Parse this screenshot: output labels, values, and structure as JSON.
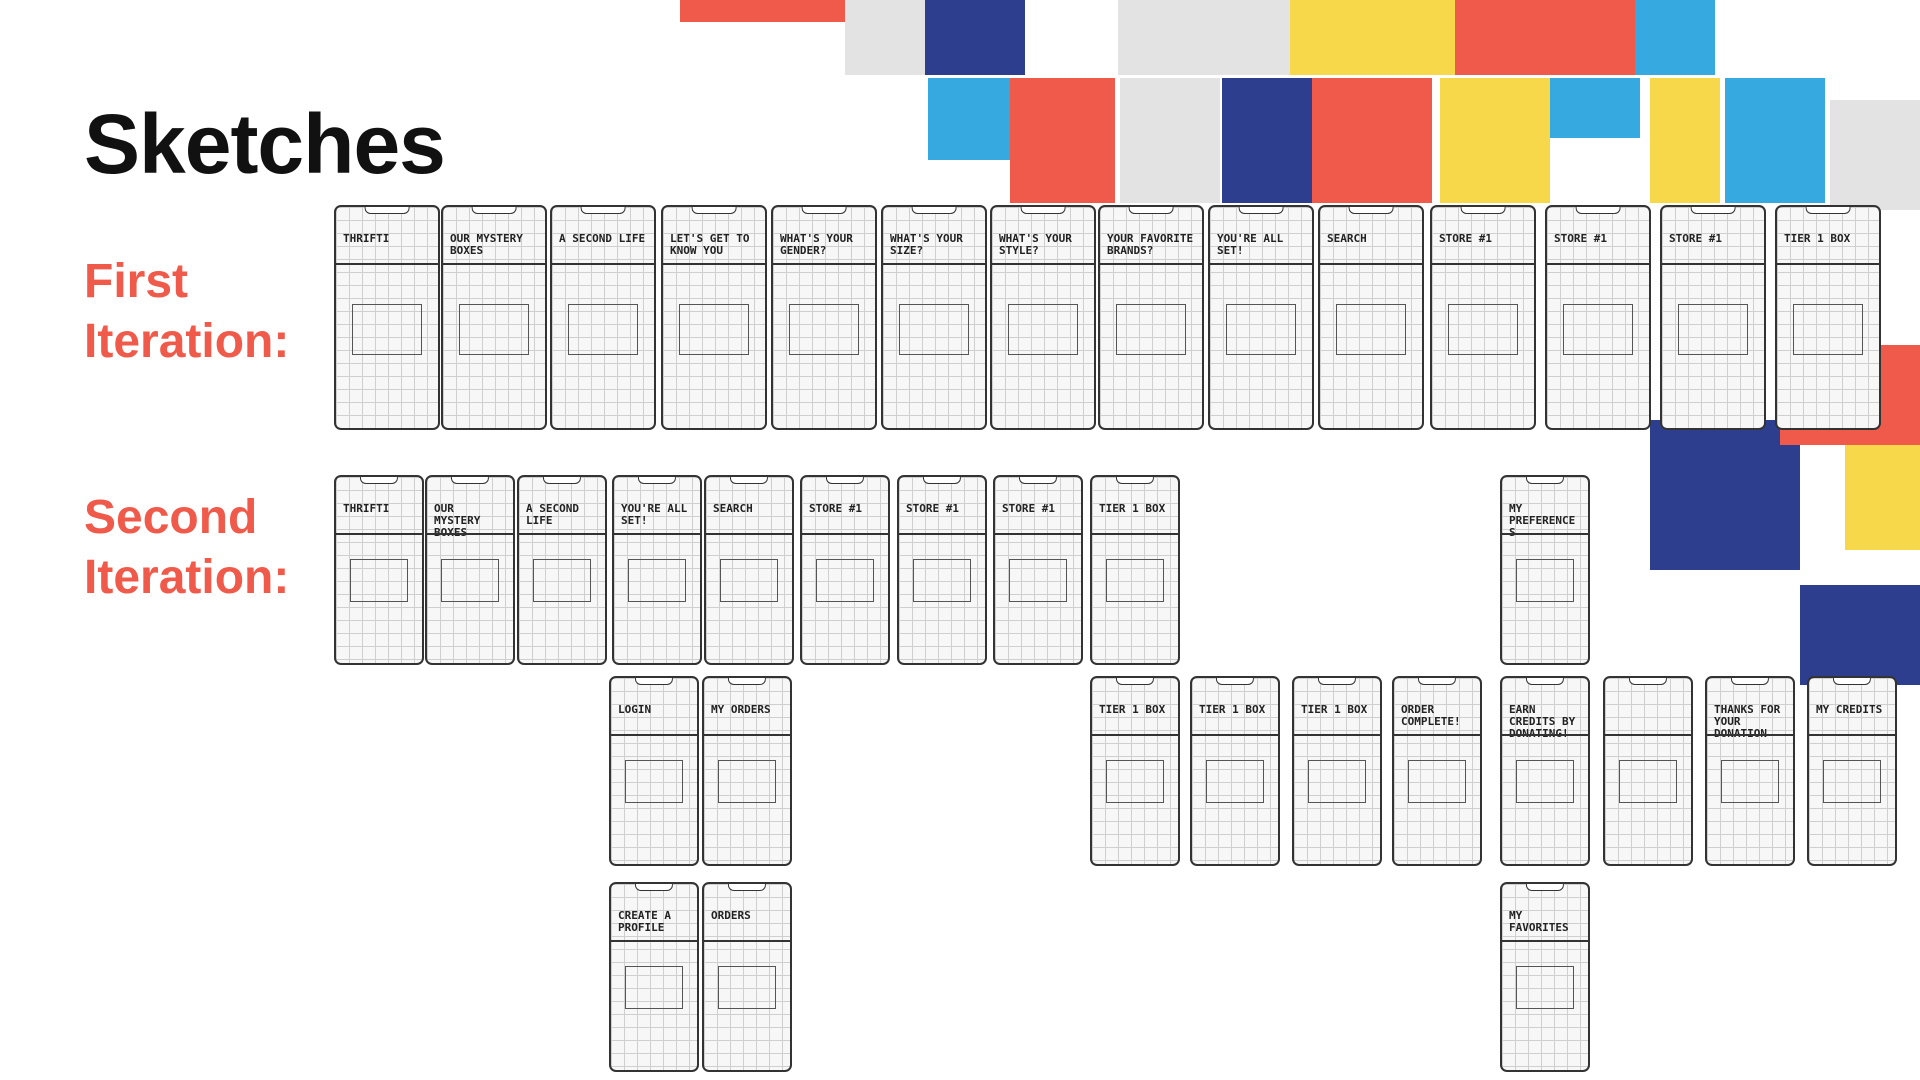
{
  "slide": {
    "title": "Sketches",
    "first_label_line1": "First",
    "first_label_line2": "Iteration:",
    "second_label_line1": "Second",
    "second_label_line2": "Iteration:"
  },
  "colors": {
    "accent": "#f05a4a",
    "blue": "#2e3e8f",
    "yellow": "#f7d84a",
    "light_blue": "#36a9e1",
    "grey": "#e3e3e3"
  },
  "sketches": {
    "first_iteration": [
      "THRIFTI",
      "OUR MYSTERY BOXES",
      "A SECOND LIFE",
      "LET'S GET TO KNOW YOU",
      "WHAT'S YOUR GENDER?",
      "WHAT'S YOUR SIZE?",
      "WHAT'S YOUR STYLE?",
      "YOUR FAVORITE BRANDS?",
      "YOU'RE ALL SET!",
      "SEARCH",
      "STORE #1",
      "STORE #1",
      "STORE #1",
      "TIER 1 BOX"
    ],
    "second_iteration_row1": [
      "THRIFTI",
      "OUR MYSTERY BOXES",
      "A SECOND LIFE",
      "YOU'RE ALL SET!",
      "SEARCH",
      "STORE #1",
      "STORE #1",
      "STORE #1",
      "TIER 1 BOX",
      "MY PREFERENCES"
    ],
    "second_iteration_row2": [
      "LOGIN",
      "MY ORDERS",
      "TIER 1 BOX",
      "TIER 1 BOX",
      "TIER 1 BOX",
      "ORDER COMPLETE!",
      "EARN CREDITS BY DONATING!",
      "",
      "THANKS FOR YOUR DONATION",
      "MY CREDITS"
    ],
    "second_iteration_row3": [
      "CREATE A PROFILE",
      "ORDERS",
      "MY FAVORITES"
    ]
  }
}
